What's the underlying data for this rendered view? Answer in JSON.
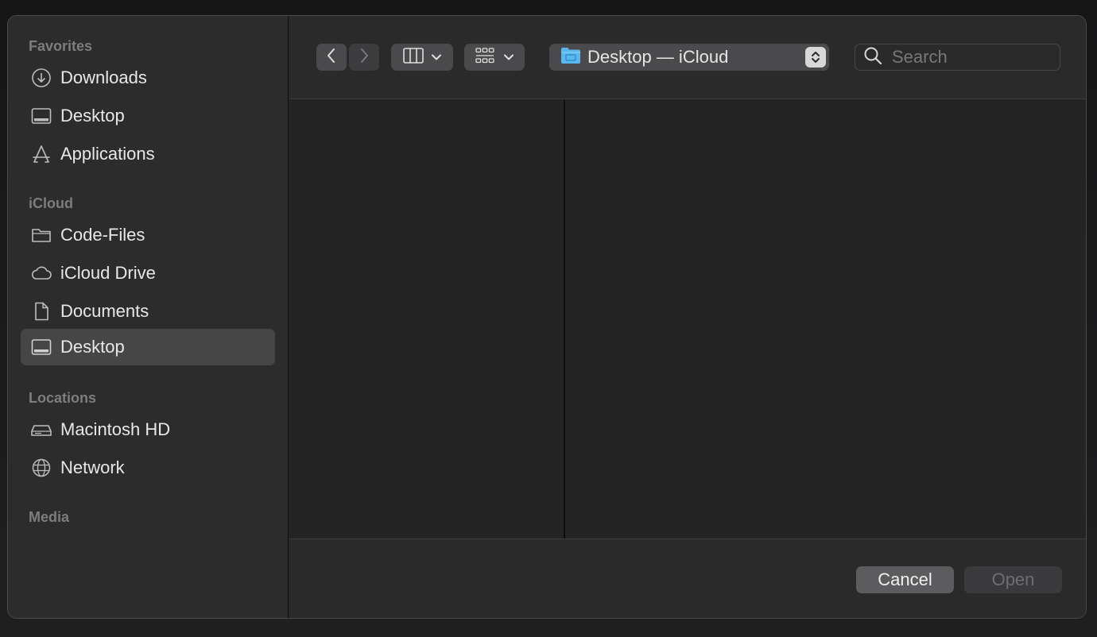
{
  "sidebar": {
    "sections": [
      {
        "title": "Favorites",
        "items": [
          {
            "label": "Downloads",
            "icon": "download-circle-icon"
          },
          {
            "label": "Desktop",
            "icon": "desktop-icon"
          },
          {
            "label": "Applications",
            "icon": "applications-icon"
          }
        ]
      },
      {
        "title": "iCloud",
        "items": [
          {
            "label": "Code-Files",
            "icon": "folder-icon"
          },
          {
            "label": "iCloud Drive",
            "icon": "cloud-icon"
          },
          {
            "label": "Documents",
            "icon": "document-icon"
          },
          {
            "label": "Desktop",
            "icon": "desktop-icon",
            "selected": true
          }
        ]
      },
      {
        "title": "Locations",
        "items": [
          {
            "label": "Macintosh HD",
            "icon": "hard-drive-icon"
          },
          {
            "label": "Network",
            "icon": "globe-icon"
          }
        ]
      },
      {
        "title": "Media",
        "items": []
      }
    ]
  },
  "toolbar": {
    "path_label": "Desktop — iCloud",
    "search_placeholder": "Search"
  },
  "footer": {
    "cancel_label": "Cancel",
    "open_label": "Open"
  },
  "colors": {
    "folder_accent": "#5ab8f0",
    "selected_row": "#464646"
  }
}
